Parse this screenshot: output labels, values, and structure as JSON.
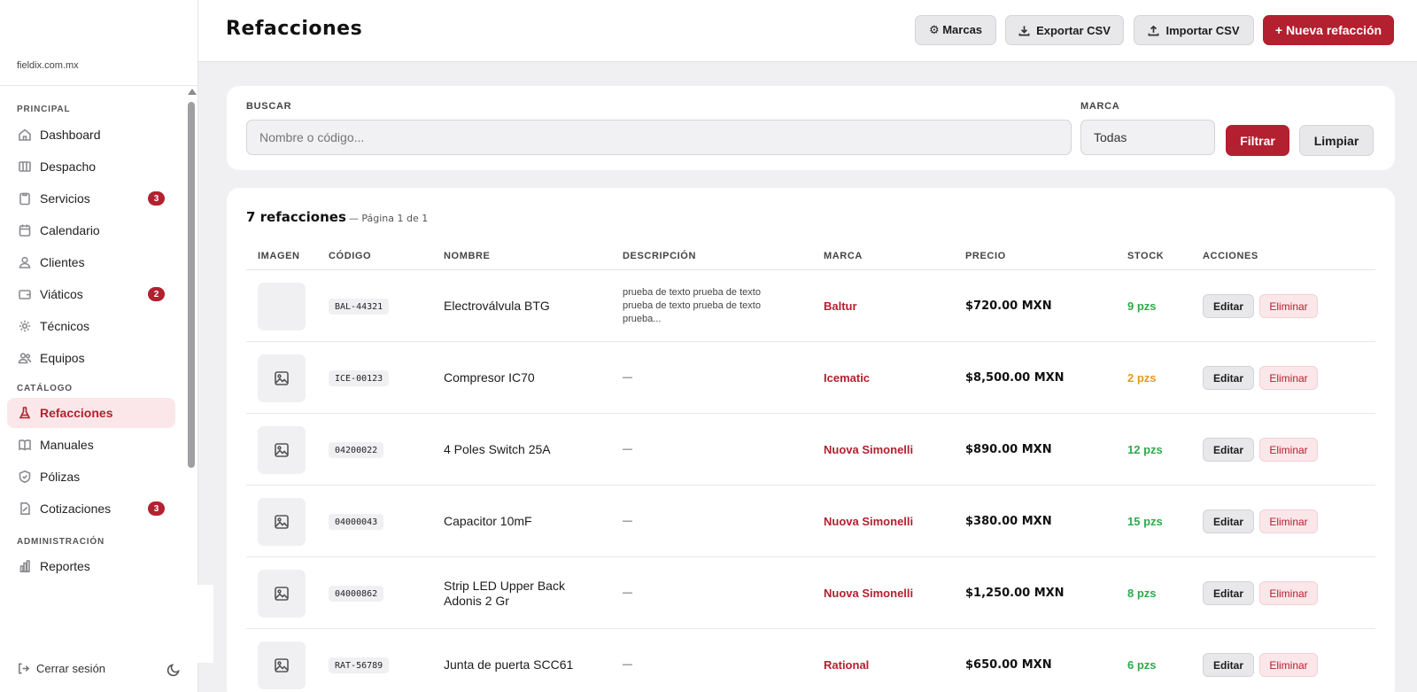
{
  "sidebar": {
    "brand": "fieldix.com.mx",
    "sections": {
      "principal": "PRINCIPAL",
      "catalogo": "CATÁLOGO",
      "administracion": "ADMINISTRACIÓN"
    },
    "items": [
      {
        "label": "Dashboard",
        "icon": "home-icon"
      },
      {
        "label": "Despacho",
        "icon": "map-icon"
      },
      {
        "label": "Servicios",
        "icon": "clipboard-icon",
        "badge": "3"
      },
      {
        "label": "Calendario",
        "icon": "calendar-icon"
      },
      {
        "label": "Clientes",
        "icon": "user-icon"
      },
      {
        "label": "Viáticos",
        "icon": "wallet-icon",
        "badge": "2"
      },
      {
        "label": "Técnicos",
        "icon": "gear-icon"
      },
      {
        "label": "Equipos",
        "icon": "users-icon"
      },
      {
        "label": "Refacciones",
        "icon": "flask-icon",
        "active": true
      },
      {
        "label": "Manuales",
        "icon": "book-icon"
      },
      {
        "label": "Pólizas",
        "icon": "shield-icon"
      },
      {
        "label": "Cotizaciones",
        "icon": "document-icon",
        "badge": "3"
      },
      {
        "label": "Reportes",
        "icon": "bar-chart-icon"
      }
    ],
    "logout": "Cerrar sesión"
  },
  "header": {
    "title": "Refacciones",
    "buttons": {
      "marcas": "⚙ Marcas",
      "exportar": "Exportar CSV",
      "importar": "Importar CSV",
      "nueva": "+ Nueva refacción"
    }
  },
  "filters": {
    "search_label": "BUSCAR",
    "search_placeholder": "Nombre o código...",
    "search_value": "",
    "brand_label": "MARCA",
    "brand_value": "Todas",
    "filter_button": "Filtrar",
    "clear_button": "Limpiar"
  },
  "table": {
    "count": "7 refacciones",
    "pagination": "— Página 1 de 1",
    "columns": [
      "IMAGEN",
      "CÓDIGO",
      "NOMBRE",
      "DESCRIPCIÓN",
      "MARCA",
      "PRECIO",
      "STOCK",
      "ACCIONES"
    ],
    "edit_label": "Editar",
    "delete_label": "Eliminar",
    "rows": [
      {
        "code": "BAL-44321",
        "name": "Electroválvula BTG",
        "description": "prueba de texto prueba de texto prueba de texto prueba de texto prueba...",
        "brand": "Baltur",
        "price": "$720.00 MXN",
        "stock": "9 pzs",
        "stock_color": "#2faa4a",
        "has_image": false
      },
      {
        "code": "ICE-00123",
        "name": "Compresor IC70",
        "description": "—",
        "brand": "Icematic",
        "price": "$8,500.00 MXN",
        "stock": "2 pzs",
        "stock_color": "#e39a1c",
        "has_image": true
      },
      {
        "code": "04200022",
        "name": "4 Poles Switch 25A",
        "description": "—",
        "brand": "Nuova Simonelli",
        "price": "$890.00 MXN",
        "stock": "12 pzs",
        "stock_color": "#2faa4a",
        "has_image": true
      },
      {
        "code": "04000043",
        "name": "Capacitor 10mF",
        "description": "—",
        "brand": "Nuova Simonelli",
        "price": "$380.00 MXN",
        "stock": "15 pzs",
        "stock_color": "#2faa4a",
        "has_image": true
      },
      {
        "code": "04000862",
        "name": "Strip LED Upper Back Adonis 2 Gr",
        "description": "—",
        "brand": "Nuova Simonelli",
        "price": "$1,250.00 MXN",
        "stock": "8 pzs",
        "stock_color": "#2faa4a",
        "has_image": true
      },
      {
        "code": "RAT-56789",
        "name": "Junta de puerta SCC61",
        "description": "—",
        "brand": "Rational",
        "price": "$650.00 MXN",
        "stock": "6 pzs",
        "stock_color": "#2faa4a",
        "has_image": true
      }
    ]
  },
  "colors": {
    "accent": "#b3202f",
    "accent_soft": "#fbe7ea",
    "background": "#f0f0f2"
  }
}
